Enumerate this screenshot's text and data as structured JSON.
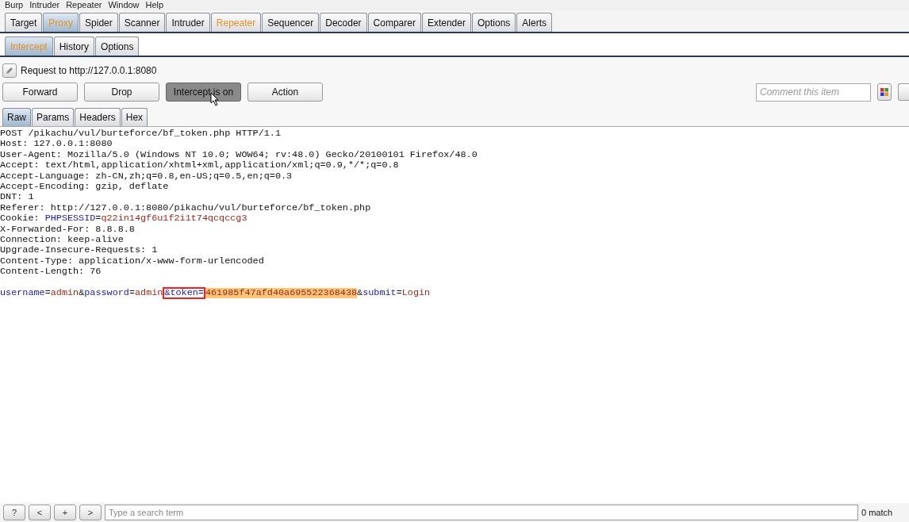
{
  "menu": [
    "Burp",
    "Intruder",
    "Repeater",
    "Window",
    "Help"
  ],
  "tabs": [
    {
      "label": "Target",
      "selected": false,
      "highlighted": false
    },
    {
      "label": "Proxy",
      "selected": true,
      "highlighted": true
    },
    {
      "label": "Spider",
      "selected": false,
      "highlighted": false
    },
    {
      "label": "Scanner",
      "selected": false,
      "highlighted": false
    },
    {
      "label": "Intruder",
      "selected": false,
      "highlighted": false
    },
    {
      "label": "Repeater",
      "selected": false,
      "highlighted": true
    },
    {
      "label": "Sequencer",
      "selected": false,
      "highlighted": false
    },
    {
      "label": "Decoder",
      "selected": false,
      "highlighted": false
    },
    {
      "label": "Comparer",
      "selected": false,
      "highlighted": false
    },
    {
      "label": "Extender",
      "selected": false,
      "highlighted": false
    },
    {
      "label": "Options",
      "selected": false,
      "highlighted": false
    },
    {
      "label": "Alerts",
      "selected": false,
      "highlighted": false
    }
  ],
  "subtabs": [
    {
      "label": "Intercept",
      "selected": true,
      "highlighted": true
    },
    {
      "label": "History",
      "selected": false,
      "highlighted": false
    },
    {
      "label": "Options",
      "selected": false,
      "highlighted": false
    }
  ],
  "request_label": "Request to http://127.0.0.1:8080",
  "buttons": [
    {
      "label": "Forward",
      "pressed": false
    },
    {
      "label": "Drop",
      "pressed": false
    },
    {
      "label": "Intercept is on",
      "pressed": true
    },
    {
      "label": "Action",
      "pressed": false
    }
  ],
  "comment": {
    "placeholder": "Comment this item"
  },
  "view_tabs": [
    {
      "label": "Raw",
      "selected": true
    },
    {
      "label": "Params",
      "selected": false
    },
    {
      "label": "Headers",
      "selected": false
    },
    {
      "label": "Hex",
      "selected": false
    }
  ],
  "headers": [
    [
      {
        "text": "POST /pikachu/vul/burteforce/bf_token.php HTTP/1.1",
        "kind": "plain"
      }
    ],
    [
      {
        "text": "Host: 127.0.0.1:8080",
        "kind": "plain"
      }
    ],
    [
      {
        "text": "User-Agent: Mozilla/5.0 (Windows NT 10.0; WOW64; rv:48.0) Gecko/20100101 Firefox/48.0",
        "kind": "plain"
      }
    ],
    [
      {
        "text": "Accept: text/html,application/xhtml+xml,application/xml;q=0.9,*/*;q=0.8",
        "kind": "plain"
      }
    ],
    [
      {
        "text": "Accept-Language: zh-CN,zh;q=0.8,en-US;q=0.5,en;q=0.3",
        "kind": "plain"
      }
    ],
    [
      {
        "text": "Accept-Encoding: gzip, deflate",
        "kind": "plain"
      }
    ],
    [
      {
        "text": "DNT: 1",
        "kind": "plain"
      }
    ],
    [
      {
        "text": "Referer: http://127.0.0.1:8080/pikachu/vul/burteforce/bf_token.php",
        "kind": "plain"
      }
    ],
    [
      {
        "text": "Cookie: ",
        "kind": "plain"
      },
      {
        "text": "PHPSESSID",
        "kind": "name"
      },
      {
        "text": "=",
        "kind": "plain"
      },
      {
        "text": "q22in14gf6u1f2i1t74qcqccg3",
        "kind": "value"
      }
    ],
    [
      {
        "text": "X-Forwarded-For: 8.8.8.8",
        "kind": "plain"
      }
    ],
    [
      {
        "text": "Connection: keep-alive",
        "kind": "plain"
      }
    ],
    [
      {
        "text": "Upgrade-Insecure-Requests: 1",
        "kind": "plain"
      }
    ],
    [
      {
        "text": "Content-Type: application/x-www-form-urlencoded",
        "kind": "plain"
      }
    ],
    [
      {
        "text": "Content-Length: 76",
        "kind": "plain"
      }
    ]
  ],
  "body": [
    [
      {
        "text": "username",
        "kind": "name"
      },
      {
        "text": "=",
        "kind": "plain"
      },
      {
        "text": "admin",
        "kind": "value"
      },
      {
        "text": "&",
        "kind": "plain"
      },
      {
        "text": "password",
        "kind": "name"
      },
      {
        "text": "=",
        "kind": "plain"
      },
      {
        "text": "admin",
        "kind": "value"
      },
      {
        "text": "&token=",
        "kind": "name",
        "boxed": true
      },
      {
        "text": "461985f47afd40a695522368438",
        "kind": "value",
        "selected": true
      },
      {
        "text": "&",
        "kind": "plain"
      },
      {
        "text": "submit",
        "kind": "name"
      },
      {
        "text": "=",
        "kind": "plain"
      },
      {
        "text": "Login",
        "kind": "value"
      }
    ]
  ],
  "search_buttons": [
    "?",
    "<",
    "+",
    ">"
  ],
  "search": {
    "placeholder": "Type a search term"
  },
  "matches": "0 match"
}
